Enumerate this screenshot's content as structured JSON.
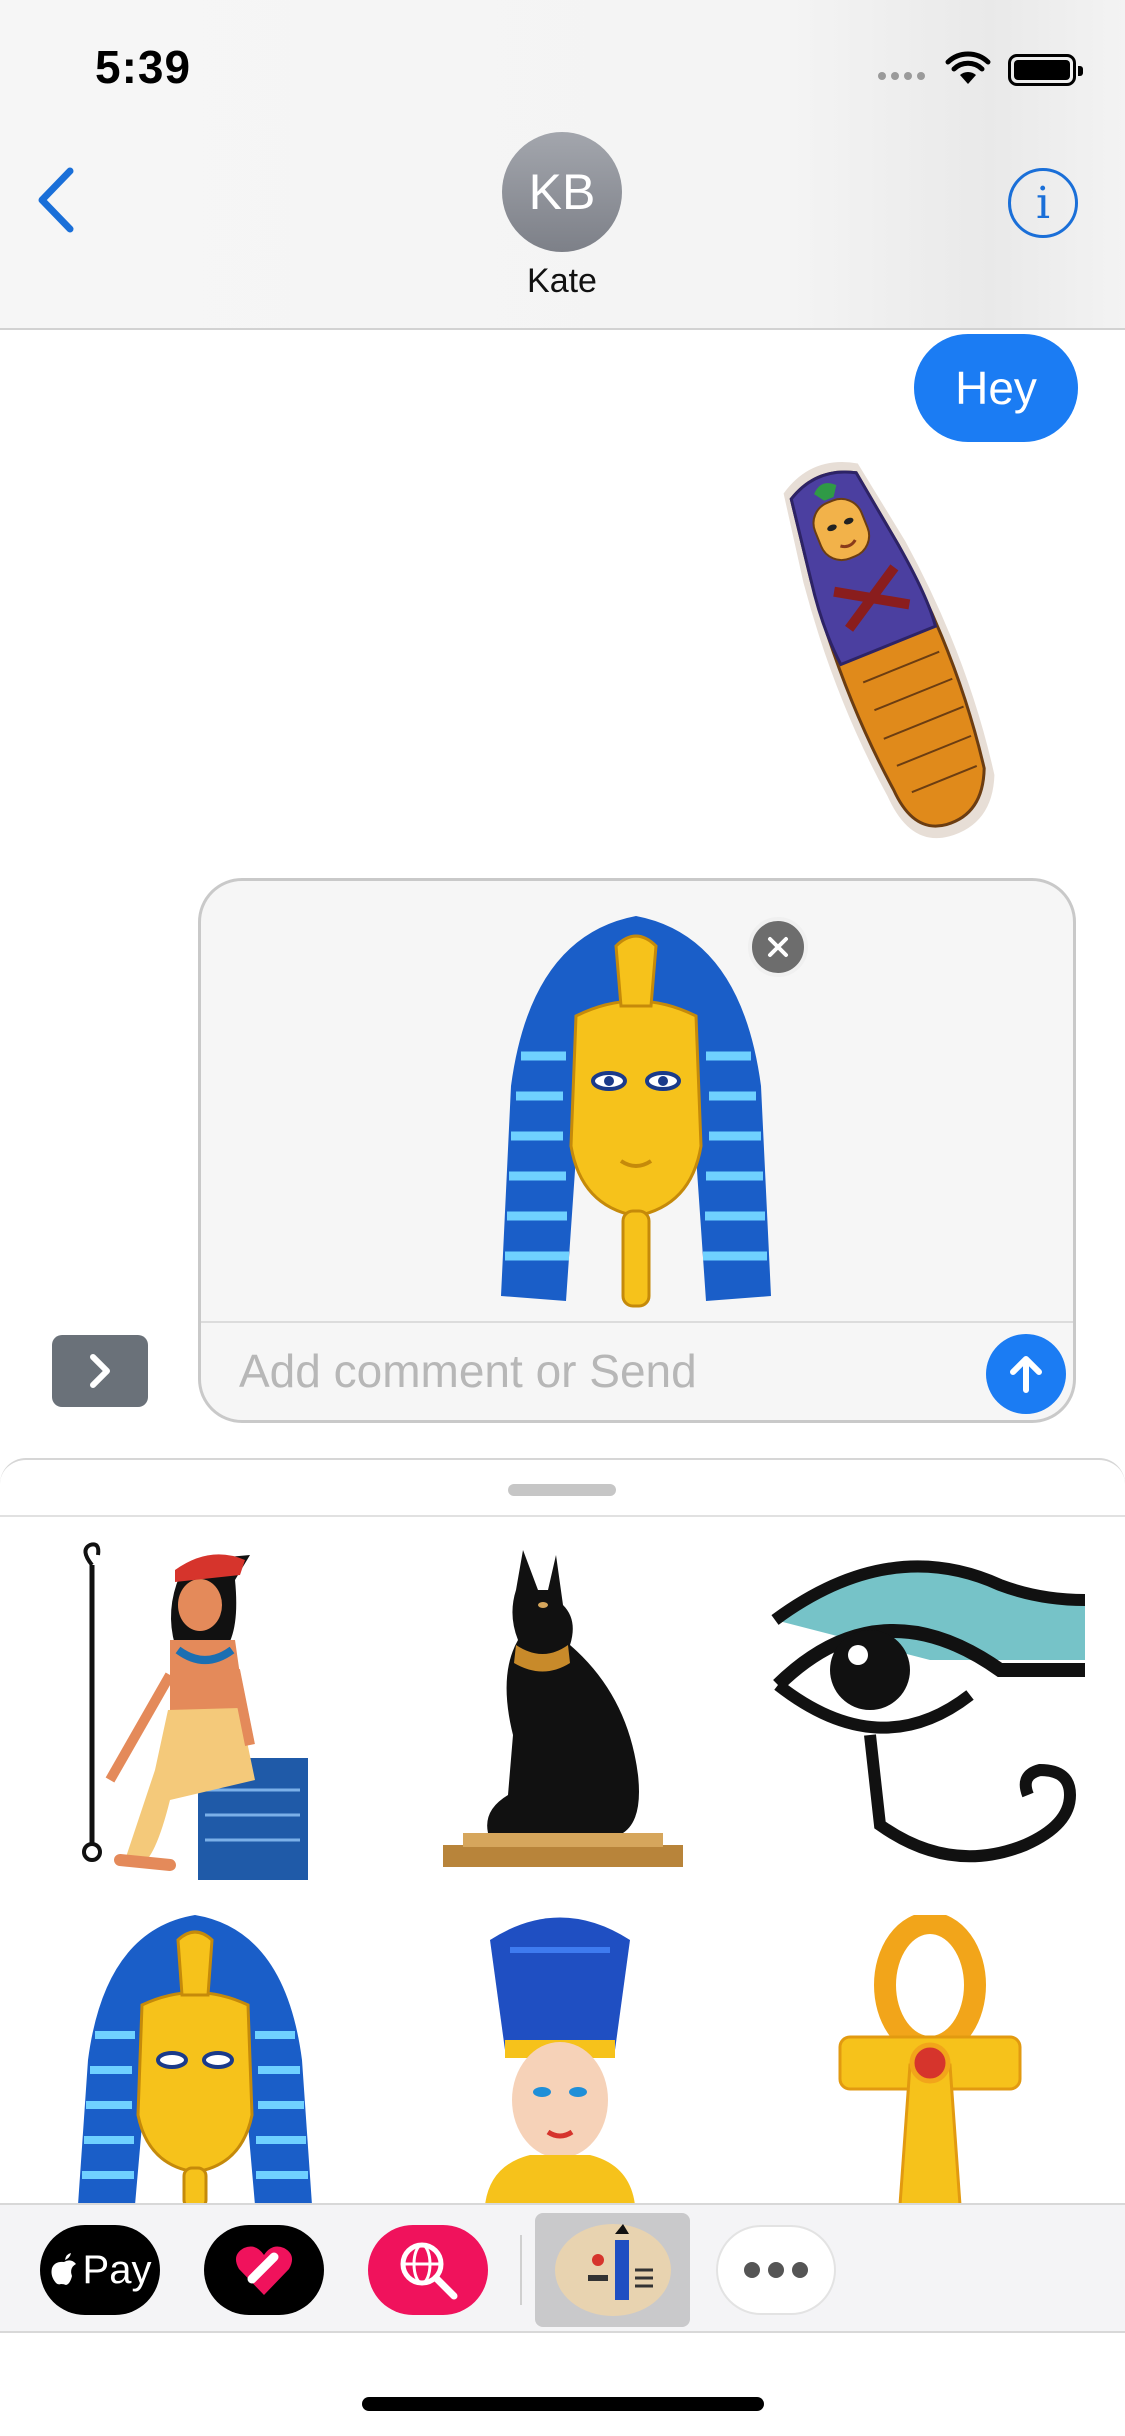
{
  "status_bar": {
    "time": "5:39"
  },
  "header": {
    "avatar_initials": "KB",
    "contact_name": "Kate",
    "info_label": "i"
  },
  "conversation": {
    "messages": [
      {
        "from": "me",
        "text": "Hey"
      }
    ]
  },
  "compose": {
    "placeholder": "Add comment or Send",
    "value": ""
  },
  "app_strip": {
    "apple_pay_label": "Pay"
  },
  "colors": {
    "accent": "#1b7cf3",
    "bubble": "#1b7cf3",
    "search_app": "#f0125c"
  },
  "stickers": [
    "seated-goddess",
    "bastet-cat",
    "eye-of-horus",
    "pharaoh-mask",
    "nefertiti",
    "ankh"
  ]
}
